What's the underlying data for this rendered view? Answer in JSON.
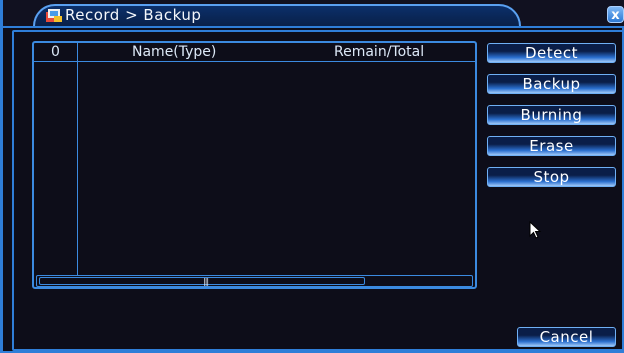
{
  "window": {
    "title": "Record > Backup",
    "close_label": "x"
  },
  "table": {
    "columns": [
      "0",
      "Name(Type)",
      "Remain/Total"
    ],
    "rows": []
  },
  "buttons": {
    "detect": "Detect",
    "backup": "Backup",
    "burning": "Burning",
    "erase": "Erase",
    "stop": "Stop",
    "cancel": "Cancel"
  },
  "icons": {
    "app": "record-app-icon",
    "close": "close-icon",
    "cursor": "mouse-pointer-icon",
    "grip": "scroll-grip-icon"
  },
  "colors": {
    "accent": "#2f7ed8",
    "background": "#0d0d19"
  }
}
